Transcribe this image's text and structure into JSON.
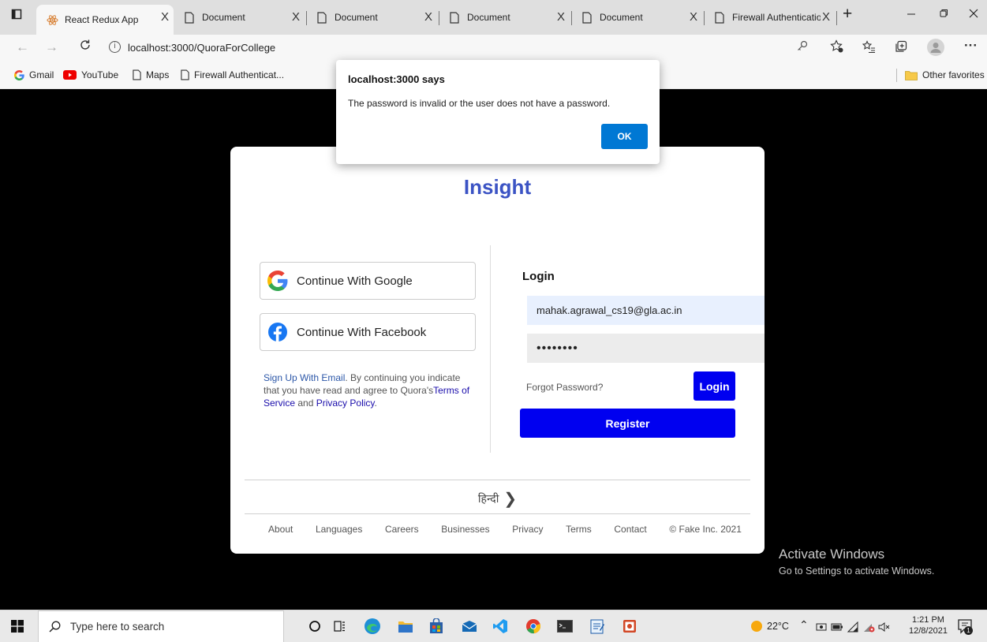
{
  "browser": {
    "tabs": [
      {
        "title": "React Redux App",
        "close": "X",
        "active": true
      },
      {
        "title": "Document",
        "close": "X"
      },
      {
        "title": "Document",
        "close": "X"
      },
      {
        "title": "Document",
        "close": "X"
      },
      {
        "title": "Document",
        "close": "X"
      },
      {
        "title": "Firewall Authentication",
        "close": "X"
      }
    ],
    "new_tab": "+",
    "url": "localhost:3000/QuoraForCollege",
    "bookmarks": [
      {
        "label": "Gmail"
      },
      {
        "label": "YouTube"
      },
      {
        "label": "Maps"
      },
      {
        "label": "Firewall Authenticat..."
      }
    ],
    "other_favorites": "Other favorites"
  },
  "dialog": {
    "title": "localhost:3000 says",
    "message": "The password is invalid or the user does not have a password.",
    "ok_label": "OK"
  },
  "card": {
    "brand": "Insight",
    "google_label": "Continue With Google",
    "facebook_label": "Continue With Facebook",
    "terms": {
      "signup_link": "Sign Up With Email",
      "text_1": ". By continuing you indicate that you have read and agree to Quora's",
      "terms_link": "Terms of Service",
      "text_2": " and ",
      "privacy_link": "Privacy Policy",
      "text_3": "."
    },
    "login": {
      "title": "Login",
      "email_value": "mahak.agrawal_cs19@gla.ac.in",
      "password_value": "••••••••",
      "forgot_label": "Forgot Password?",
      "login_label": "Login",
      "register_label": "Register"
    },
    "language_label": "हिन्दी",
    "footer_links": [
      "About",
      "Languages",
      "Careers",
      "Businesses",
      "Privacy",
      "Terms",
      "Contact",
      "© Fake Inc. 2021"
    ]
  },
  "watermark": {
    "title": "Activate Windows",
    "subtitle": "Go to Settings to activate Windows."
  },
  "taskbar": {
    "search_placeholder": "Type here to search",
    "weather": "22°C",
    "time": "1:21 PM",
    "date": "12/8/2021",
    "notification_count": "1"
  },
  "colors": {
    "brand": "#3b53c4",
    "primary_button": "#0000f0",
    "dialog_ok": "#0078d4",
    "email_bg": "#e8f0fe"
  }
}
